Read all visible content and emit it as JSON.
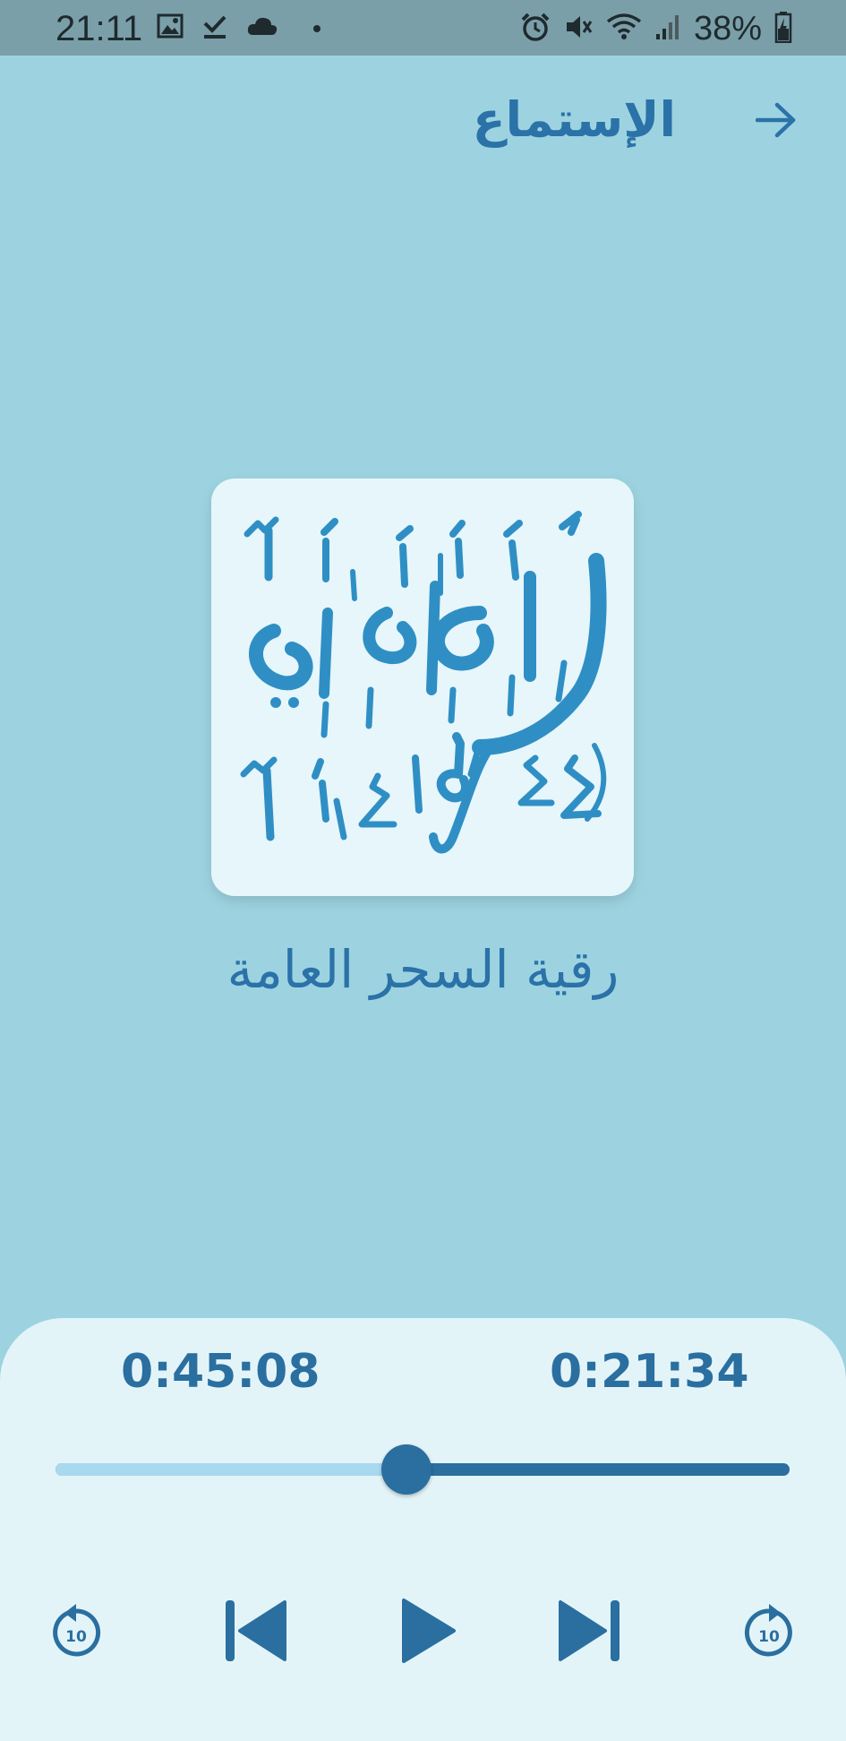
{
  "status_bar": {
    "time": "21:11",
    "battery": "38%",
    "left_icons": [
      "image-icon",
      "download-done-icon",
      "cloud-icon",
      "dot-icon"
    ],
    "right_icons": [
      "alarm-icon",
      "mute-icon",
      "wifi-icon",
      "signal-icon",
      "battery-icon"
    ]
  },
  "header": {
    "title": "الإستماع",
    "back_icon": "arrow-right-icon"
  },
  "track": {
    "artwork_text": "العامة",
    "title": "رقية السحر العامة"
  },
  "player": {
    "duration": "0:45:08",
    "elapsed": "0:21:34",
    "progress_fraction": 0.478,
    "rewind_seconds": "10",
    "forward_seconds": "10"
  },
  "colors": {
    "background": "#9dd3e0",
    "accent": "#2a6f9f",
    "panel": "#e3f4f9",
    "status_bar": "#7a9fa8"
  }
}
